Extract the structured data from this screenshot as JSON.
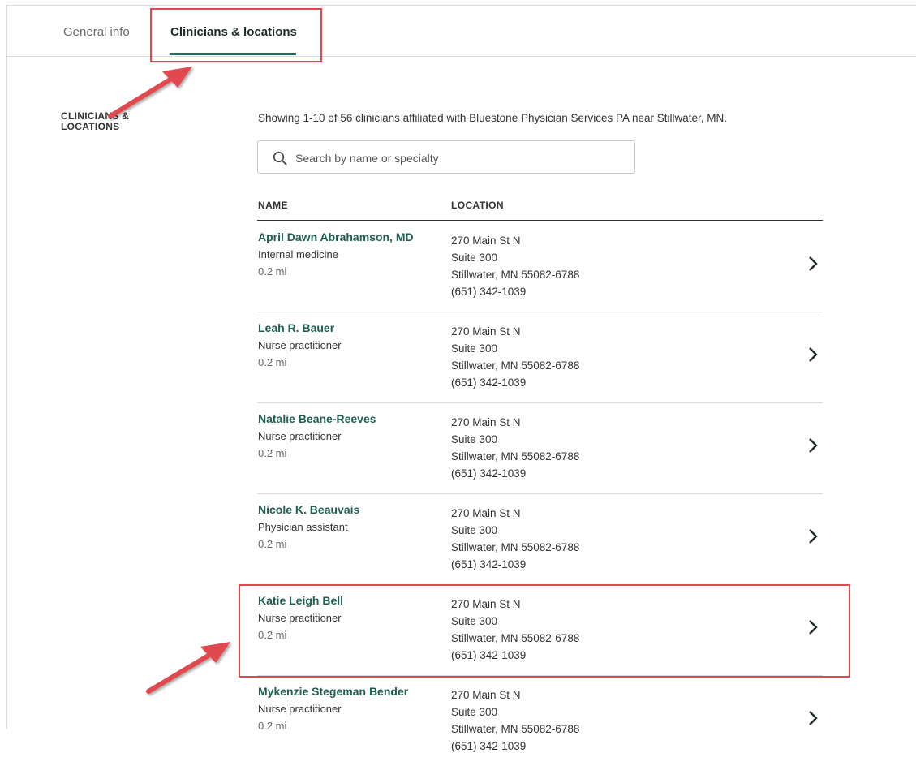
{
  "tabs": [
    {
      "label": "General info"
    },
    {
      "label": "Clinicians & locations"
    }
  ],
  "section": {
    "title": "CLINICIANS & LOCATIONS"
  },
  "summary": {
    "text": "Showing 1-10 of 56 clinicians affiliated with Bluestone Physician Services PA near Stillwater, MN."
  },
  "search": {
    "placeholder": "Search by name or specialty",
    "icon": "search-icon"
  },
  "table": {
    "headers": {
      "name": "NAME",
      "location": "LOCATION"
    },
    "rows": [
      {
        "name": "April Dawn Abrahamson, MD",
        "specialty": "Internal medicine",
        "distance": "0.2 mi",
        "address": [
          "270 Main St N",
          "Suite 300",
          "Stillwater, MN 55082-6788",
          "(651) 342-1039"
        ]
      },
      {
        "name": "Leah R. Bauer",
        "specialty": "Nurse practitioner",
        "distance": "0.2 mi",
        "address": [
          "270 Main St N",
          "Suite 300",
          "Stillwater, MN 55082-6788",
          "(651) 342-1039"
        ]
      },
      {
        "name": "Natalie Beane-Reeves",
        "specialty": "Nurse practitioner",
        "distance": "0.2 mi",
        "address": [
          "270 Main St N",
          "Suite 300",
          "Stillwater, MN 55082-6788",
          "(651) 342-1039"
        ]
      },
      {
        "name": "Nicole K. Beauvais",
        "specialty": "Physician assistant",
        "distance": "0.2 mi",
        "address": [
          "270 Main St N",
          "Suite 300",
          "Stillwater, MN 55082-6788",
          "(651) 342-1039"
        ]
      },
      {
        "name": "Katie Leigh Bell",
        "specialty": "Nurse practitioner",
        "distance": "0.2 mi",
        "address": [
          "270 Main St N",
          "Suite 300",
          "Stillwater, MN 55082-6788",
          "(651) 342-1039"
        ]
      },
      {
        "name": "Mykenzie Stegeman Bender",
        "specialty": "Nurse practitioner",
        "distance": "0.2 mi",
        "address": [
          "270 Main St N",
          "Suite 300",
          "Stillwater, MN 55082-6788",
          "(651) 342-1039"
        ]
      }
    ]
  },
  "colors": {
    "accent": "#1f6b57",
    "link": "#1f5e52",
    "annotation": "#e0494d"
  }
}
